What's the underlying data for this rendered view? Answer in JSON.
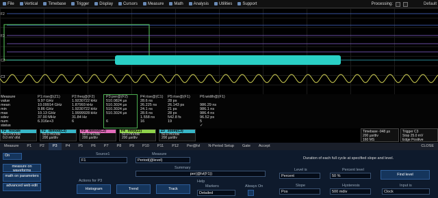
{
  "menu": [
    {
      "label": "File",
      "icon": "file-icon"
    },
    {
      "label": "Vertical",
      "icon": "vertical-icon"
    },
    {
      "label": "Timebase",
      "icon": "timebase-icon"
    },
    {
      "label": "Trigger",
      "icon": "trigger-icon"
    },
    {
      "label": "Display",
      "icon": "display-icon"
    },
    {
      "label": "Cursors",
      "icon": "cursors-icon"
    },
    {
      "label": "Measure",
      "icon": "measure-icon"
    },
    {
      "label": "Math",
      "icon": "math-icon"
    },
    {
      "label": "Analysis",
      "icon": "analysis-icon"
    },
    {
      "label": "Utilities",
      "icon": "utilities-icon"
    },
    {
      "label": "Support",
      "icon": "support-icon"
    }
  ],
  "processing_label": "Processing:",
  "default_label": "Default",
  "trace_labels": [
    "F2",
    "F3",
    "C2",
    "C3"
  ],
  "measure": {
    "columns": [
      "Measure",
      "P1:rise@(Z1)",
      "P2:freq@(F2)",
      "P3:per@(F2)",
      "P4:rise@(C1)",
      "P5:rise@(F1)",
      "P6:width@(F1)"
    ],
    "rows": [
      [
        "value",
        "9.97 GHz",
        "1.9230722 kHz",
        "510.0824 µs",
        "28.6 ns",
        "28 ps",
        ""
      ],
      [
        "mean",
        "10.09914 GHz",
        "1.87993 kHz",
        "510.3024 µs",
        "26.225 ns",
        "26.143 ps",
        "986.29 ns"
      ],
      [
        "min",
        "9.86 GHz",
        "1.9230722 kHz",
        "510.3024 µs",
        "24.1 ns",
        "21 ps",
        "986.1 ns"
      ],
      [
        "max",
        "10.13 GHz",
        "1.9999928 kHz",
        "510.3024 µs",
        "28.6 ns",
        "28 ps",
        "986.4 ns"
      ],
      [
        "sdev",
        "37.90 MHz",
        "31.84 Hz",
        "",
        "1.558 ns",
        "542.8 fs",
        "96.52 ps"
      ],
      [
        "num",
        "6.316e+3",
        "6",
        "6",
        "16",
        "19",
        "5"
      ],
      [
        "status",
        "",
        "",
        "",
        "",
        "",
        "✓"
      ]
    ]
  },
  "channels": [
    {
      "name": "F2",
      "sub": "rescale",
      "lines": [
        "50.0 mV/div",
        "0.0 mV ofst"
      ],
      "color": "#37b7c7"
    },
    {
      "name": "F2",
      "sub": "demod(C2)",
      "lines": [
        "50.0 mV/div",
        "200 µs/div"
      ],
      "color": "#37b7c7"
    },
    {
      "name": "F3",
      "sub": "demod(C2)",
      "lines": [
        "50.0 mV/div",
        "200 µs/div"
      ],
      "color": "#e36cba"
    },
    {
      "name": "F4",
      "sub": "intrp(Z2)",
      "lines": [
        "50.0 mV/div",
        "200 µs/div"
      ],
      "color": "#8fd34a"
    },
    {
      "name": "Z3",
      "sub": "zoom(C3)",
      "lines": [
        "50.0 mV/div",
        "200 µs/div"
      ],
      "color": "#37b7c7"
    }
  ],
  "timebase": {
    "title": "Timebase",
    "val": "-948 µs",
    "lines": [
      "200 µs/div",
      "160 MS",
      "20 MS/s"
    ]
  },
  "trigger": {
    "title": "Trigger",
    "val": "C3",
    "lines": [
      "Stop",
      "25.0 mV",
      "Edge",
      "Positive"
    ]
  },
  "tabs": [
    "Measure",
    "P1",
    "P2",
    "P3",
    "P4",
    "P5",
    "P6",
    "P7",
    "P8",
    "P9",
    "P10",
    "P11",
    "P12",
    "Per@lvl",
    "N-Period Setup",
    "Gate",
    "Accept"
  ],
  "close_label": "CLOSE",
  "panel": {
    "on_label": "On",
    "views": [
      "measure on waveforms",
      "math on parameters",
      "advanced web edit"
    ],
    "source1_label": "Source1",
    "source1_value": "F1",
    "measure_label": "Measure",
    "measure_value": "Period(@level)",
    "summary_label": "Summary",
    "summary_value": "per(@lvl(F1))",
    "help_label": "Help",
    "actions_label": "Actions for P3",
    "actions": [
      "Histogram",
      "Trend",
      "Track"
    ],
    "markers_label": "Markers",
    "markers_value": "Detailed",
    "always_on_label": "Always On",
    "description": "Duration of each full cycle at specified slope and level.",
    "level_is_label": "Level is",
    "level_is_value": "Percent",
    "percent_label": "Percent level",
    "percent_value": "50 %",
    "find_level": "Find level",
    "slope_label": "Slope",
    "slope_value": "Pos",
    "hysteresis_label": "Hysteresis",
    "hysteresis_value": "500 mdiv",
    "input_label": "Input is",
    "input_value": "Clock"
  }
}
